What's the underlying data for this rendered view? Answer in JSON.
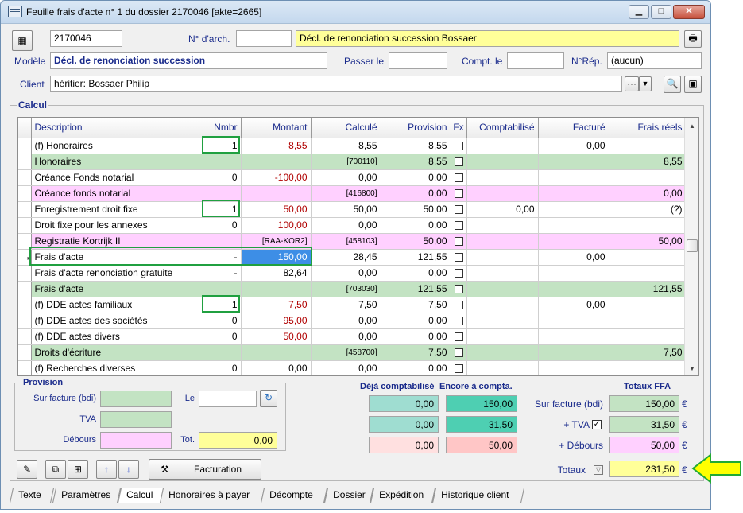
{
  "window": {
    "title": "Feuille frais d'acte n° 1 du dossier 2170046 [akte=2665]"
  },
  "header": {
    "dossier": "2170046",
    "narch_label": "N° d'arch.",
    "narch_value": "",
    "description": "Décl. de renonciation succession Bossaer",
    "modele_label": "Modèle",
    "modele_value": "Décl. de renonciation succession",
    "passer_label": "Passer le",
    "passer_value": "",
    "compt_label": "Compt. le",
    "compt_value": "",
    "nrep_label": "N°Rép.",
    "nrep_value": "(aucun)",
    "client_label": "Client",
    "client_value": "héritier: Bossaer Philip",
    "client_more": "···"
  },
  "calcul": {
    "legend": "Calcul",
    "columns": [
      "Description",
      "Nmbr",
      "Montant",
      "Calculé",
      "Provision",
      "Fx",
      "Comptabilisé",
      "Facturé",
      "Frais réels"
    ],
    "rows": [
      {
        "desc": "(f) Honoraires",
        "nmbr": "1",
        "montant": "8,55",
        "calcule": "8,55",
        "provision": "8,55",
        "compt": "",
        "facture": "0,00",
        "frais": ""
      },
      {
        "desc": "Honoraires",
        "nmbr": "",
        "montant": "",
        "calcule": "[700110]",
        "provision": "8,55",
        "compt": "",
        "facture": "",
        "frais": "8,55"
      },
      {
        "desc": "Créance Fonds notarial",
        "nmbr": "0",
        "montant": "-100,00",
        "calcule": "0,00",
        "provision": "0,00",
        "compt": "",
        "facture": "",
        "frais": ""
      },
      {
        "desc": "Créance fonds notarial",
        "nmbr": "",
        "montant": "",
        "calcule": "[416800]",
        "provision": "0,00",
        "compt": "",
        "facture": "",
        "frais": "0,00"
      },
      {
        "desc": "Enregistrement droit fixe",
        "nmbr": "1",
        "montant": "50,00",
        "calcule": "50,00",
        "provision": "50,00",
        "compt": "0,00",
        "facture": "",
        "frais": "(?)"
      },
      {
        "desc": "Droit fixe pour les annexes",
        "nmbr": "0",
        "montant": "100,00",
        "calcule": "0,00",
        "provision": "0,00",
        "compt": "",
        "facture": "",
        "frais": ""
      },
      {
        "desc": "Registratie Kortrijk II",
        "nmbr": "",
        "montant": "[RAA-KOR2]",
        "calcule": "[458103]",
        "provision": "50,00",
        "compt": "",
        "facture": "",
        "frais": "50,00"
      },
      {
        "desc": "Frais d'acte",
        "nmbr": "-",
        "montant": "150,00",
        "calcule": "28,45",
        "provision": "121,55",
        "compt": "",
        "facture": "0,00",
        "frais": ""
      },
      {
        "desc": "Frais d'acte renonciation gratuite",
        "nmbr": "-",
        "montant": "82,64",
        "calcule": "0,00",
        "provision": "0,00",
        "compt": "",
        "facture": "",
        "frais": ""
      },
      {
        "desc": "Frais d'acte",
        "nmbr": "",
        "montant": "",
        "calcule": "[703030]",
        "provision": "121,55",
        "compt": "",
        "facture": "",
        "frais": "121,55"
      },
      {
        "desc": "(f) DDE actes familiaux",
        "nmbr": "1",
        "montant": "7,50",
        "calcule": "7,50",
        "provision": "7,50",
        "compt": "",
        "facture": "0,00",
        "frais": ""
      },
      {
        "desc": "(f) DDE actes des sociétés",
        "nmbr": "0",
        "montant": "95,00",
        "calcule": "0,00",
        "provision": "0,00",
        "compt": "",
        "facture": "",
        "frais": ""
      },
      {
        "desc": "(f) DDE actes divers",
        "nmbr": "0",
        "montant": "50,00",
        "calcule": "0,00",
        "provision": "0,00",
        "compt": "",
        "facture": "",
        "frais": ""
      },
      {
        "desc": "Droits d'écriture",
        "nmbr": "",
        "montant": "",
        "calcule": "[458700]",
        "provision": "7,50",
        "compt": "",
        "facture": "",
        "frais": "7,50"
      },
      {
        "desc": "(f) Recherches diverses",
        "nmbr": "0",
        "montant": "0,00",
        "calcule": "0,00",
        "provision": "0,00",
        "compt": "",
        "facture": "",
        "frais": ""
      }
    ]
  },
  "provision": {
    "legend": "Provision",
    "sur_facture_label": "Sur facture (bdi)",
    "tva_label": "TVA",
    "debours_label": "Débours",
    "le_label": "Le",
    "tot_label": "Tot.",
    "tot_value": "0,00"
  },
  "summary": {
    "deja_label": "Déjà comptabilisé",
    "encore_label": "Encore à compta.",
    "totaux_ffa_label": "Totaux FFA",
    "sur_facture_label": "Sur facture (bdi)",
    "tva_label": "+ TVA",
    "debours_label": "+ Débours",
    "totaux_label": "Totaux",
    "deja": [
      "0,00",
      "0,00",
      "0,00"
    ],
    "encore": [
      "150,00",
      "31,50",
      "50,00"
    ],
    "ffa": [
      "150,00",
      "31,50",
      "50,00"
    ],
    "total": "231,50",
    "currency": "€"
  },
  "toolbar": {
    "facturation_label": "Facturation"
  },
  "tabs": [
    "Texte",
    "Paramètres",
    "Calcul",
    "Honoraires à payer",
    "Décompte",
    "Dossier",
    "Expédition",
    "Historique client"
  ],
  "colors": {
    "highlight": "#ffff99",
    "green": "#c3e3c3",
    "pink": "#ffd0ff",
    "arrow": "#ffff00"
  }
}
